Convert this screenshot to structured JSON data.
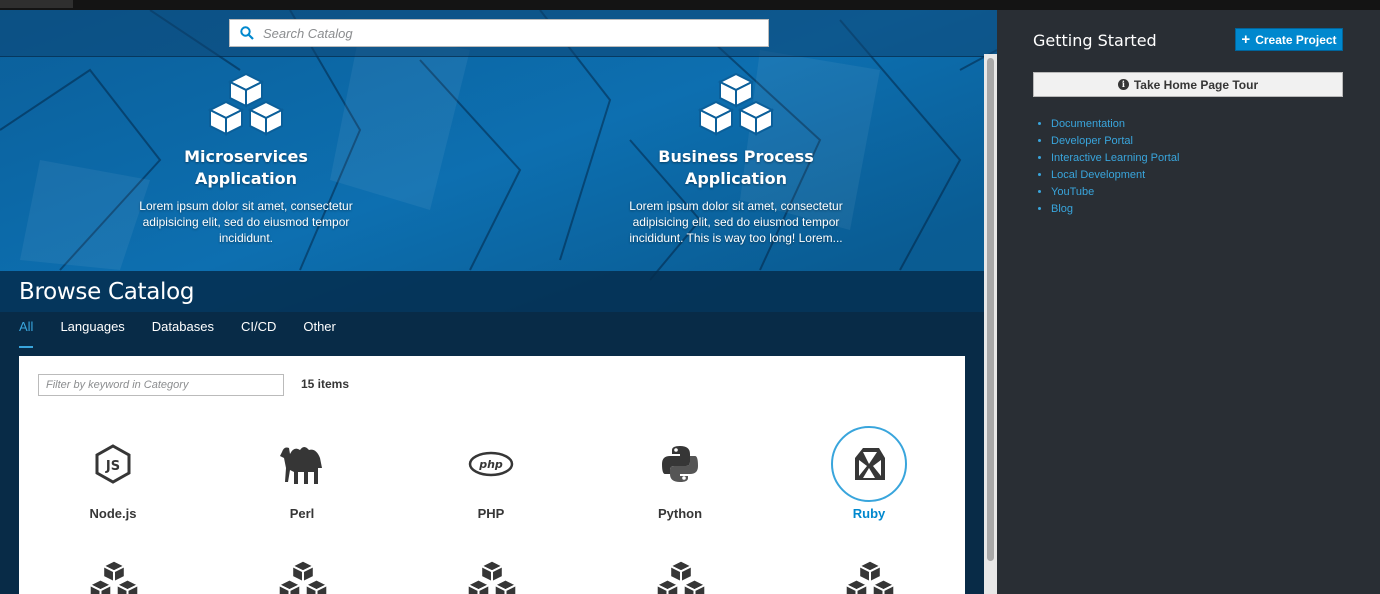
{
  "search": {
    "placeholder": "Search Catalog"
  },
  "features": [
    {
      "title": "Microservices Application",
      "description": "Lorem ipsum dolor sit amet, consectetur adipisicing elit, sed do eiusmod tempor incididunt."
    },
    {
      "title": "Business Process Application",
      "description": "Lorem ipsum dolor sit amet, consectetur adipisicing elit, sed do eiusmod tempor incididunt. This is way too long! Lorem..."
    }
  ],
  "browse": {
    "title": "Browse Catalog",
    "tabs": [
      "All",
      "Languages",
      "Databases",
      "CI/CD",
      "Other"
    ],
    "active_tab": "All",
    "filter_placeholder": "Filter by keyword in Category",
    "count": "15 items",
    "items": [
      {
        "label": "Node.js",
        "icon": "nodejs-icon"
      },
      {
        "label": "Perl",
        "icon": "camel-icon"
      },
      {
        "label": "PHP",
        "icon": "php-icon"
      },
      {
        "label": "Python",
        "icon": "python-icon"
      },
      {
        "label": "Ruby",
        "icon": "ruby-gem-icon",
        "selected": true
      }
    ],
    "colors": {
      "accent": "#0088ce",
      "active_tab": "#39a5dc"
    }
  },
  "sidebar": {
    "title": "Getting Started",
    "create_label": "Create Project",
    "tour_label": "Take Home Page Tour",
    "links": [
      "Documentation",
      "Developer Portal",
      "Interactive Learning Portal",
      "Local Development",
      "YouTube",
      "Blog"
    ]
  }
}
